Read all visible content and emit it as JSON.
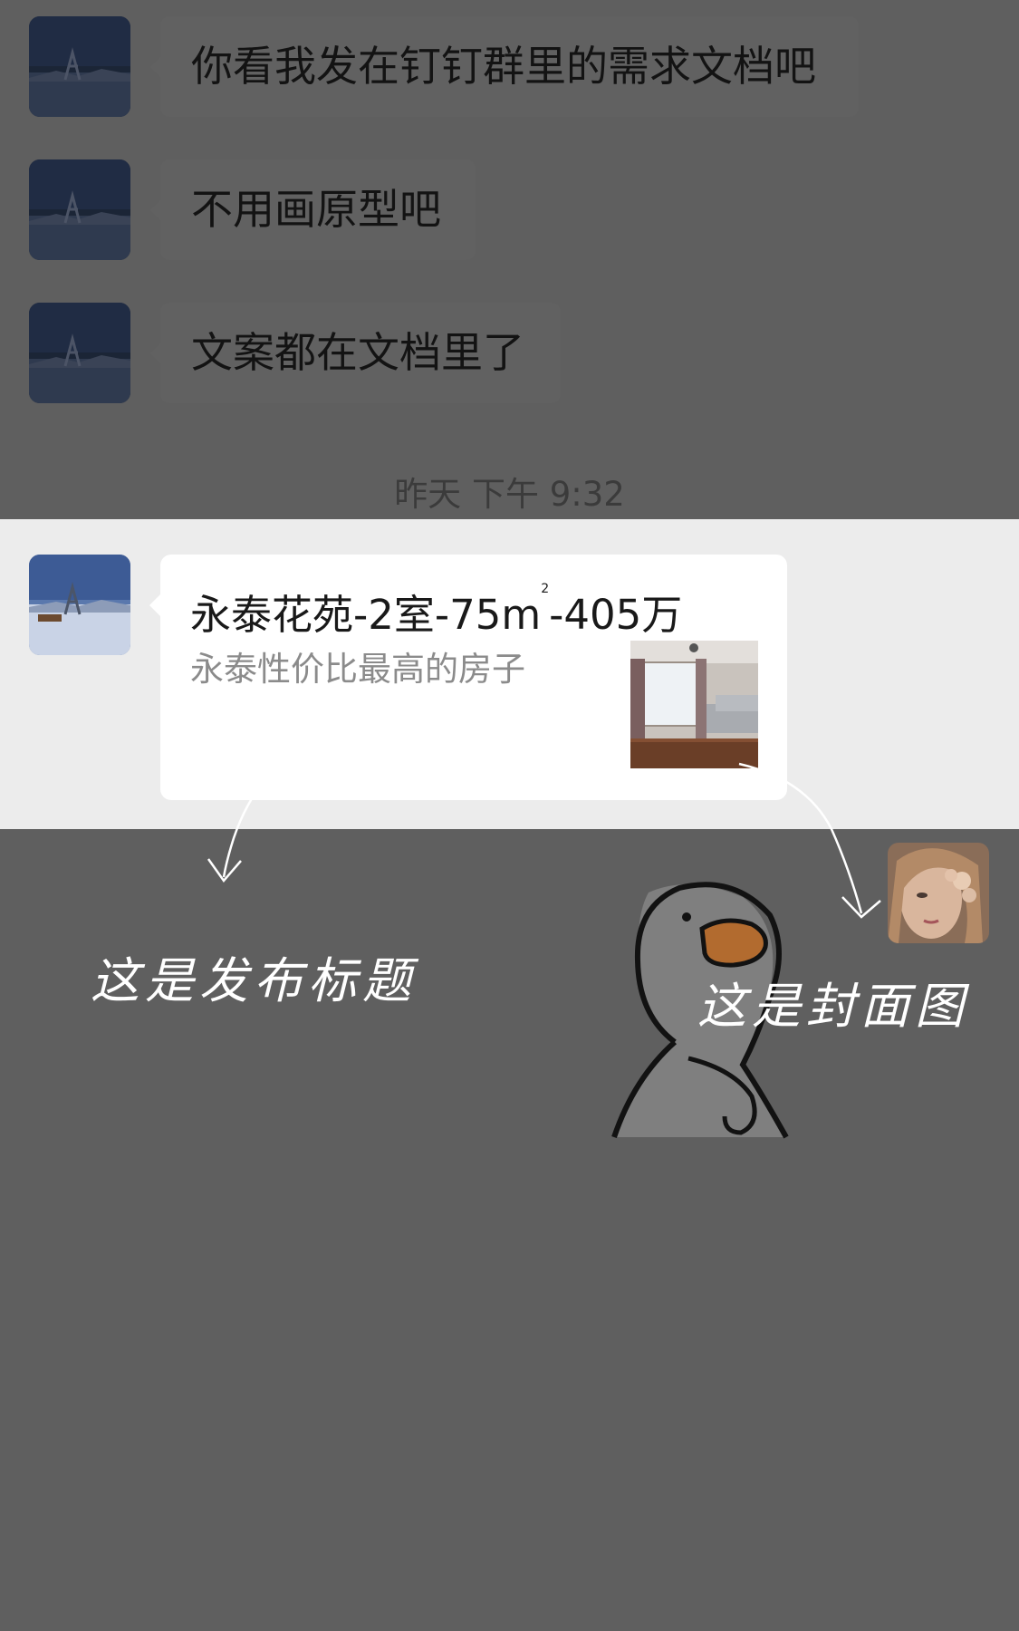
{
  "messages": [
    {
      "text": "你看我发在钉钉群里的需求文档吧"
    },
    {
      "text": "不用画原型吧"
    },
    {
      "text": "文案都在文档里了"
    }
  ],
  "timestamp": "昨天 下午 9:32",
  "card": {
    "title_prefix": "永泰花苑-2室-75",
    "title_unit": "m",
    "title_sup": "2",
    "title_suffix": "-405万",
    "description": "永泰性价比最高的房子"
  },
  "annotations": {
    "title_note": "这是发布标题",
    "cover_note": "这是封面图"
  },
  "colors": {
    "background_dim": "#5f5f5f",
    "bubble_dim": "#616161",
    "highlight_band": "#ececec",
    "card_bg": "#ffffff"
  }
}
